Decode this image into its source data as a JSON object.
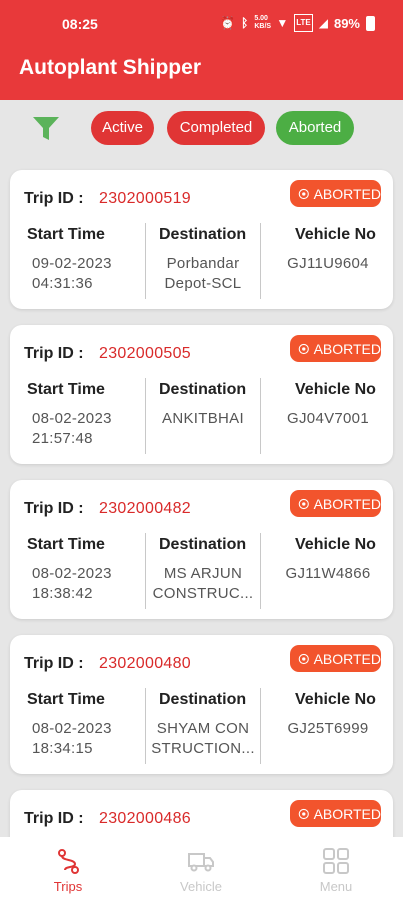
{
  "status_bar": {
    "time": "08:25",
    "network": "5.00 KB/S",
    "network_type": "LTE",
    "battery": "89%"
  },
  "app": {
    "title": "Autoplant Shipper",
    "accent_color": "#e8393a"
  },
  "filters": {
    "icon": "filter-icon",
    "chips": [
      {
        "label": "Active",
        "color": "#e03535"
      },
      {
        "label": "Completed",
        "color": "#e03535"
      },
      {
        "label": "Aborted",
        "color": "#4cae44",
        "selected": true
      }
    ]
  },
  "labels": {
    "trip_id": "Trip ID :",
    "start_time": "Start Time",
    "destination": "Destination",
    "vehicle_no": "Vehicle No"
  },
  "trips": [
    {
      "trip_id": "2302000519",
      "status": "ABORTED",
      "start_date": "09-02-2023",
      "start_clock": "04:31:36",
      "dest_line1": "Porbandar",
      "dest_line2": "Depot-SCL",
      "vehicle": "GJ11U9604"
    },
    {
      "trip_id": "2302000505",
      "status": "ABORTED",
      "start_date": "08-02-2023",
      "start_clock": "21:57:48",
      "dest_line1": "ANKITBHAI",
      "dest_line2": "",
      "vehicle": "GJ04V7001"
    },
    {
      "trip_id": "2302000482",
      "status": "ABORTED",
      "start_date": "08-02-2023",
      "start_clock": "18:38:42",
      "dest_line1": "MS ARJUN",
      "dest_line2": "CONSTRUC...",
      "vehicle": "GJ11W4866"
    },
    {
      "trip_id": "2302000480",
      "status": "ABORTED",
      "start_date": "08-02-2023",
      "start_clock": "18:34:15",
      "dest_line1": "SHYAM CON",
      "dest_line2": "STRUCTION...",
      "vehicle": "GJ25T6999"
    },
    {
      "trip_id": "2302000486",
      "status": "ABORTED"
    }
  ],
  "bottom_nav": [
    {
      "label": "Trips",
      "icon": "route-icon",
      "active": true
    },
    {
      "label": "Vehicle",
      "icon": "truck-icon",
      "active": false
    },
    {
      "label": "Menu",
      "icon": "grid-icon",
      "active": false
    }
  ]
}
